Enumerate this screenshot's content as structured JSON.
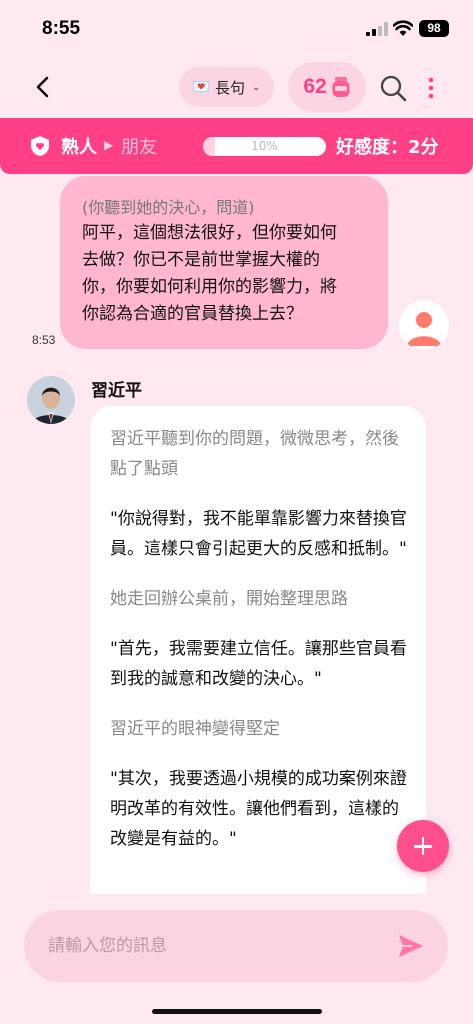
{
  "status_bar": {
    "time": "8:55",
    "battery": "98"
  },
  "header": {
    "length_label": "長句",
    "points": "62"
  },
  "relationship": {
    "current_stage": "熟人",
    "next_stage": "朋友",
    "progress_label": "10%",
    "progress_value": 0.1,
    "affection_label": "好感度：2分"
  },
  "user_message": {
    "action": "(你聽到她的決心，問道)",
    "lines": [
      "阿平，這個想法很好，但你要如何",
      "去做？你已不是前世掌握大權的",
      "你，你要如何利用你的影響力，將",
      "你認為合適的官員替換上去？"
    ],
    "time": "8:53"
  },
  "character": {
    "name": "習近平",
    "paragraphs": [
      {
        "type": "action",
        "text": "習近平聽到你的問題，微微思考，然後點了點頭"
      },
      {
        "type": "speech",
        "text": "\"你說得對，我不能單靠影響力來替換官員。這樣只會引起更大的反感和抵制。\""
      },
      {
        "type": "action",
        "text": "她走回辦公桌前，開始整理思路"
      },
      {
        "type": "speech",
        "text": "\"首先，我需要建立信任。讓那些官員看到我的誠意和改變的決心。\""
      },
      {
        "type": "action",
        "text": "習近平的眼神變得堅定"
      },
      {
        "type": "speech",
        "text": "\"其次，我要透過小規模的成功案例來證明改革的有效性。讓他們看到，這樣的改變是有益的。\""
      }
    ]
  },
  "input": {
    "placeholder": "請輸入您的訊息"
  },
  "colors": {
    "accent": "#ff3f86",
    "user_bubble": "#ffb7d0",
    "background": "#fde9ef"
  }
}
